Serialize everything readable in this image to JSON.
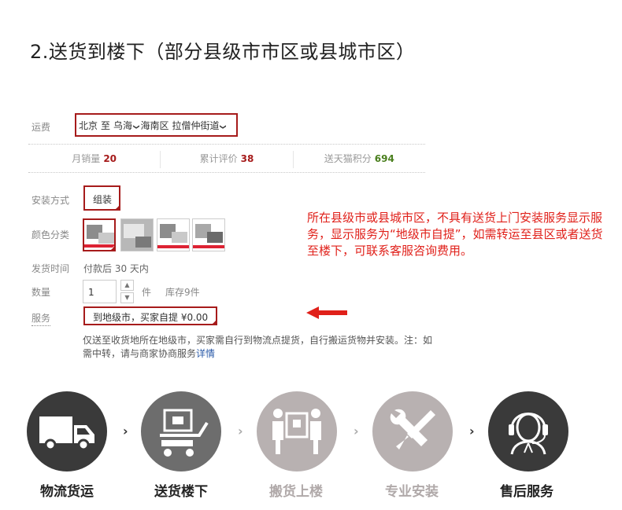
{
  "page_title": "2.送货到楼下（部分县级市市区或县城市区）",
  "shipping": {
    "label": "运费",
    "from": "北京",
    "to_word": "至",
    "city": "乌海",
    "district": "海南区",
    "street": "拉僧仲街道",
    "chevron": "❯"
  },
  "stats": {
    "monthly_sales_label": "月销量",
    "monthly_sales_value": "20",
    "reviews_label": "累计评价",
    "reviews_value": "38",
    "points_label": "送天猫积分",
    "points_value": "694"
  },
  "install": {
    "label": "安装方式",
    "option": "组装"
  },
  "color": {
    "label": "颜色分类"
  },
  "delivery": {
    "label": "发货时间",
    "value": "付款后 30 天内"
  },
  "quantity": {
    "label": "数量",
    "value": "1",
    "unit": "件",
    "stock": "库存9件",
    "up": "▲",
    "down": "▼"
  },
  "service": {
    "label": "服务",
    "option": "到地级市，买家自提 ¥0.00"
  },
  "note": {
    "text": "仅送至收货地所在地级市，买家需自行到物流点提货，自行搬运货物并安装。注：如需中转，请与商家协商服务",
    "link": "详情"
  },
  "annotation": "所在县级市或县城市区，不具有送货上门安装服务显示服务，显示服务为“地级市自提”，如需转运至县区或者送货至楼下，可联系客服咨询费用。",
  "steps": [
    {
      "label": "物流货运",
      "icon": "truck-icon",
      "active": true
    },
    {
      "label": "送货楼下",
      "icon": "hand-truck-icon",
      "active": true
    },
    {
      "label": "搬货上楼",
      "icon": "movers-icon",
      "active": false
    },
    {
      "label": "专业安装",
      "icon": "tools-icon",
      "active": false
    },
    {
      "label": "售后服务",
      "icon": "headset-icon",
      "active": true
    }
  ],
  "step_chevron": "›",
  "colors": {
    "accent_red": "#a61b1b",
    "annotation_red": "#e0201a",
    "step_active": "#3a3a3a",
    "step_mid": "#6d6d6d",
    "step_inactive": "#b8b1b1"
  }
}
